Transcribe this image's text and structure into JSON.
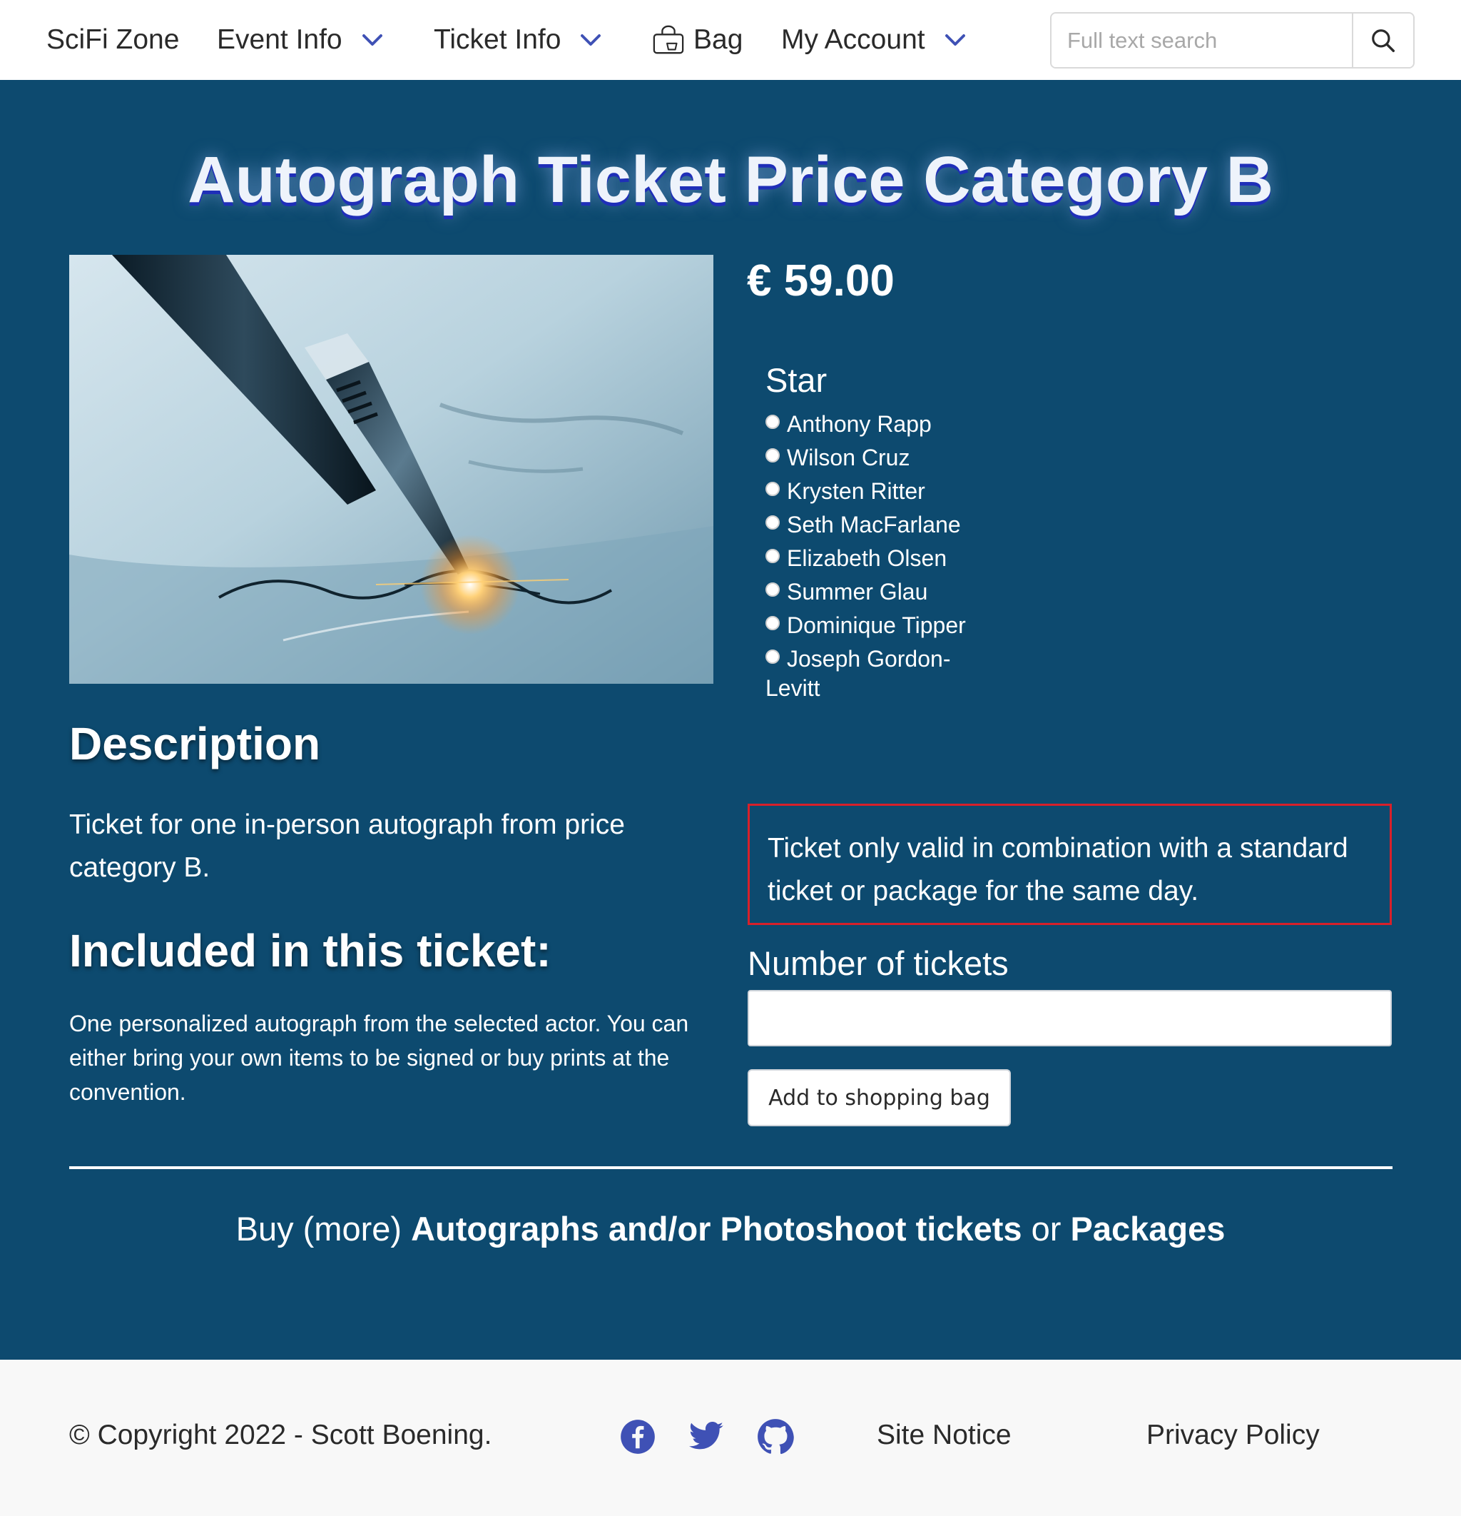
{
  "nav": {
    "brand": "SciFi Zone",
    "event_info": "Event Info",
    "ticket_info": "Ticket Info",
    "bag": "Bag",
    "my_account": "My Account",
    "search_placeholder": "Full text search"
  },
  "product": {
    "title": "Autograph Ticket Price Category B",
    "price": "€ 59.00",
    "image_icon": "fountain-pen-signing-image"
  },
  "star": {
    "legend": "Star",
    "options": [
      "Anthony Rapp",
      "Wilson Cruz",
      "Krysten Ritter",
      "Seth MacFarlane",
      "Elizabeth Olsen",
      "Summer Glau",
      "Dominique Tipper",
      "Joseph Gordon-Levitt"
    ]
  },
  "notice": "Ticket only valid in combination with a standard ticket or package for the same day.",
  "order": {
    "number_label": "Number of tickets",
    "number_value": "",
    "add_button": "Add to shopping bag"
  },
  "description": {
    "heading": "Description",
    "text": "Ticket for one in-person autograph from price category B.",
    "included_heading": "Included in this ticket:",
    "included_text": "One personalized autograph from the selected actor. You can either bring your own items to be signed or buy prints at the convention."
  },
  "bottom": {
    "prefix": "Buy (more) ",
    "link1": "Autographs and/or Photoshoot tickets",
    "middle": " or ",
    "link2": "Packages"
  },
  "footer": {
    "copyright": "© Copyright 2022 - Scott Boening.",
    "site_notice": "Site Notice",
    "privacy_policy": "Privacy Policy"
  },
  "colors": {
    "main_bg": "#0d4a6f",
    "accent_icon": "#3f51b5",
    "notice_border": "#d8202a"
  }
}
